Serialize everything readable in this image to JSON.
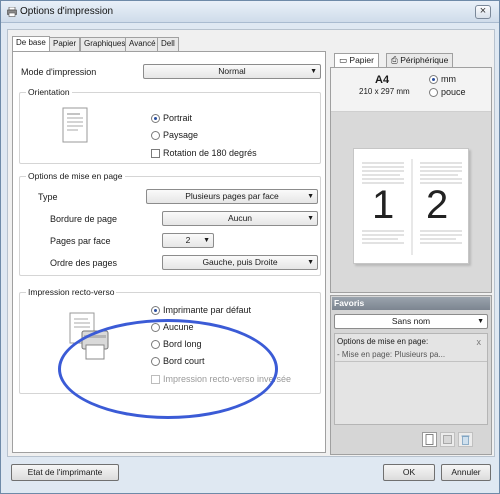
{
  "window": {
    "title": "Options d'impression",
    "close_label": "×"
  },
  "tabs": [
    {
      "label": "De base",
      "active": true
    },
    {
      "label": "Papier"
    },
    {
      "label": "Graphiques"
    },
    {
      "label": "Avancé"
    },
    {
      "label": "Dell"
    }
  ],
  "left": {
    "print_mode_label": "Mode d'impression",
    "print_mode_value": "Normal",
    "orientation_group": "Orientation",
    "orientation_options": [
      "Portrait",
      "Paysage"
    ],
    "rotate_label": "Rotation de 180 degrés",
    "layout_group": "Options de mise en page",
    "type_label": "Type",
    "type_value": "Plusieurs pages par face",
    "border_label": "Bordure de page",
    "border_value": "Aucun",
    "pages_per_side_label": "Pages par face",
    "pages_per_side_value": "2",
    "page_order_label": "Ordre des pages",
    "page_order_value": "Gauche, puis Droite",
    "duplex_group": "Impression recto-verso",
    "duplex_options": [
      "Imprimante par défaut",
      "Aucune",
      "Bord long",
      "Bord court"
    ],
    "duplex_reverse_label": "Impression recto-verso inversée"
  },
  "right": {
    "tabs": [
      "Papier",
      "Périphérique"
    ],
    "paper_size": "A4",
    "paper_dims": "210 x 297 mm",
    "unit_options": [
      "mm",
      "pouce"
    ],
    "preview_pages": [
      "1",
      "2"
    ],
    "favorites_title": "Favoris",
    "favorites_value": "Sans nom",
    "favorites_list_header": "Options de mise en page:",
    "favorites_list_item": "- Mise en page: Plusieurs pa...",
    "favorites_remove": "x"
  },
  "footer": {
    "printer_status": "Etat de l'imprimante",
    "ok": "OK",
    "cancel": "Annuler"
  },
  "colors": {
    "highlight": "#3b5bd6",
    "title_gradient": "#cfdcea"
  }
}
